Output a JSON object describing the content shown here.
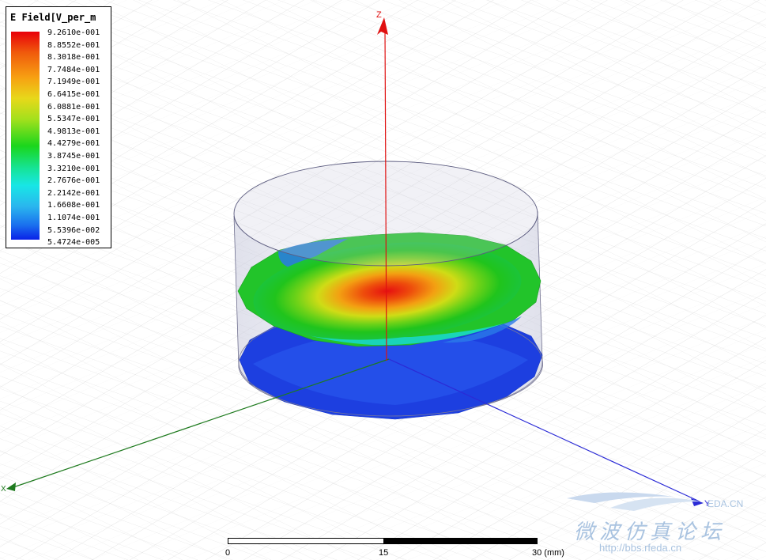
{
  "legend": {
    "title": "E Field[V_per_m",
    "values": [
      "9.2610e-001",
      "8.8552e-001",
      "8.3018e-001",
      "7.7484e-001",
      "7.1949e-001",
      "6.6415e-001",
      "6.0881e-001",
      "5.5347e-001",
      "4.9813e-001",
      "4.4279e-001",
      "3.8745e-001",
      "3.3210e-001",
      "2.7676e-001",
      "2.2142e-001",
      "1.6608e-001",
      "1.1074e-001",
      "5.5396e-002",
      "5.4724e-005"
    ]
  },
  "axes": {
    "z": "Z",
    "x": "X",
    "y": "Y"
  },
  "axis_colors": {
    "x": "#1e7a1e",
    "y": "#2b2bd6",
    "z": "#e01010"
  },
  "scale": {
    "start": "0",
    "mid": "15",
    "end": "30 (mm)"
  },
  "watermark": {
    "brand": "EDA.CN",
    "chinese": "微波仿真论坛",
    "url": "http://bbs.rfeda.cn"
  }
}
